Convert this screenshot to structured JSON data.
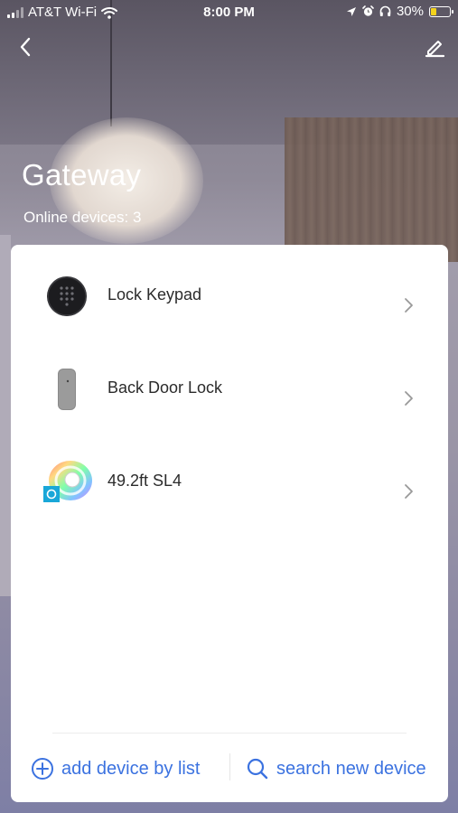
{
  "status_bar": {
    "carrier": "AT&T Wi-Fi",
    "time": "8:00 PM",
    "battery_percent": "30%",
    "battery_level": 0.3,
    "battery_color": "#f3d21b"
  },
  "nav": {
    "back_icon": "chevron-left-icon",
    "edit_icon": "edit-pencil-icon"
  },
  "header": {
    "title": "Gateway",
    "online_devices": "Online devices: 3"
  },
  "devices": [
    {
      "name": "Lock Keypad",
      "icon": "keypad-icon"
    },
    {
      "name": "Back Door Lock",
      "icon": "door-lock-icon"
    },
    {
      "name": "49.2ft SL4",
      "icon": "light-strip-icon"
    }
  ],
  "footer": {
    "add_label": "add device by list",
    "search_label": "search new device",
    "accent_color": "#3b72e0"
  }
}
